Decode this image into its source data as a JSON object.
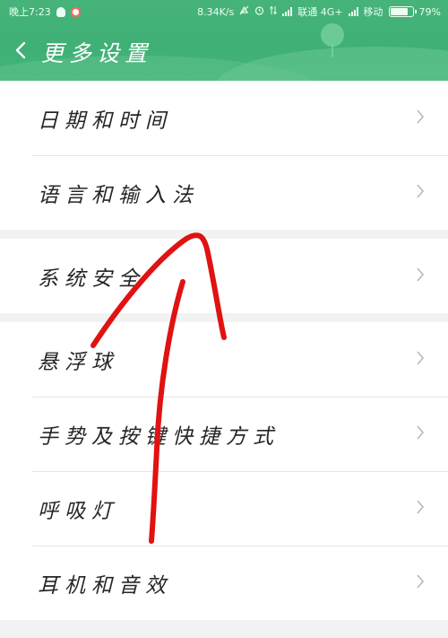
{
  "status_bar": {
    "time": "晚上7:23",
    "speed": "8.34K/s",
    "carrier1": "联通 4G+",
    "carrier2": "移动",
    "battery": "79%"
  },
  "header": {
    "title": "更多设置",
    "back_icon": "back-arrow-icon"
  },
  "groups": [
    {
      "items": [
        {
          "label": "日期和时间"
        },
        {
          "label": "语言和输入法"
        }
      ]
    },
    {
      "items": [
        {
          "label": "系统安全"
        }
      ]
    },
    {
      "items": [
        {
          "label": "悬浮球"
        },
        {
          "label": "手势及按键快捷方式"
        },
        {
          "label": "呼吸灯"
        },
        {
          "label": "耳机和音效"
        }
      ]
    }
  ],
  "colors": {
    "header_green": "#43b47a",
    "annotation_red": "#e01212",
    "chevron": "#b8b8b8"
  }
}
